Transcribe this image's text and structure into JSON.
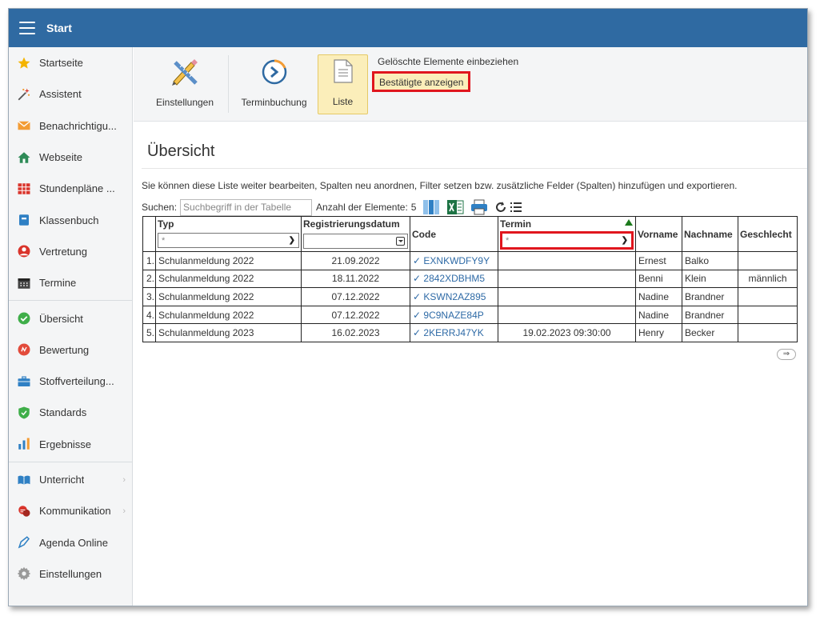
{
  "header": {
    "title": "Start"
  },
  "sidebar": {
    "group1": [
      {
        "label": "Startseite",
        "icon": "star-icon",
        "color": "#f4b400"
      },
      {
        "label": "Assistent",
        "icon": "magic-wand-icon",
        "color": "#d9342b"
      },
      {
        "label": "Benachrichtigu...",
        "icon": "envelope-icon",
        "color": "#f39c34"
      },
      {
        "label": "Webseite",
        "icon": "house-icon",
        "color": "#2e8b57"
      },
      {
        "label": "Stundenpläne ...",
        "icon": "grid-calendar-icon",
        "color": "#d9342b"
      },
      {
        "label": "Klassenbuch",
        "icon": "book-icon",
        "color": "#2f80c4"
      },
      {
        "label": "Vertretung",
        "icon": "person-icon",
        "color": "#d9342b"
      },
      {
        "label": "Termine",
        "icon": "calendar-icon",
        "color": "#444444"
      }
    ],
    "group2": [
      {
        "label": "Übersicht",
        "icon": "check-circle-icon",
        "color": "#3fae49"
      },
      {
        "label": "Bewertung",
        "icon": "rating-circle-icon",
        "color": "#e24b3b"
      },
      {
        "label": "Stoffverteilung...",
        "icon": "briefcase-icon",
        "color": "#2f80c4"
      },
      {
        "label": "Standards",
        "icon": "shield-check-icon",
        "color": "#3fae49"
      },
      {
        "label": "Ergebnisse",
        "icon": "bar-chart-icon",
        "color": "#2f80c4"
      }
    ],
    "group3": [
      {
        "label": "Unterricht",
        "icon": "open-book-icon",
        "color": "#2f80c4",
        "chevron": "›"
      },
      {
        "label": "Kommunikation",
        "icon": "chat-bubbles-icon",
        "color": "#d9342b",
        "chevron": "›"
      },
      {
        "label": "Agenda Online",
        "icon": "pen-icon",
        "color": "#2f80c4"
      },
      {
        "label": "Einstellungen",
        "icon": "gear-icon",
        "color": "#9a9a9a"
      }
    ]
  },
  "toolbar": {
    "einstellungen": "Einstellungen",
    "terminbuchung": "Terminbuchung",
    "liste": "Liste",
    "deleted_option": "Gelöschte Elemente einbeziehen",
    "confirmed_option": "Bestätigte anzeigen"
  },
  "main": {
    "title": "Übersicht",
    "description": "Sie können diese Liste weiter bearbeiten, Spalten neu anordnen, Filter setzen bzw. zusätzliche Felder (Spalten) hinzufügen und exportieren.",
    "search_label": "Suchen:",
    "search_placeholder": "Suchbegriff in der Tabelle",
    "count_label": "Anzahl der Elemente:",
    "count_value": "5"
  },
  "table": {
    "headers": {
      "typ": "Typ",
      "reg": "Registrierungsdatum",
      "code": "Code",
      "termin": "Termin",
      "vorname": "Vorname",
      "nachname": "Nachname",
      "geschlecht": "Geschlecht"
    },
    "filters": {
      "typ": "*",
      "termin": "*"
    },
    "rows": [
      {
        "idx": "1.",
        "typ": "Schulanmeldung 2022",
        "reg": "21.09.2022",
        "code": "✓ EXNKWDFY9Y",
        "termin": "",
        "vorname": "Ernest",
        "nachname": "Balko",
        "geschlecht": ""
      },
      {
        "idx": "2.",
        "typ": "Schulanmeldung 2022",
        "reg": "18.11.2022",
        "code": "✓ 2842XDBHM5",
        "termin": "",
        "vorname": "Benni",
        "nachname": "Klein",
        "geschlecht": "männlich"
      },
      {
        "idx": "3.",
        "typ": "Schulanmeldung 2022",
        "reg": "07.12.2022",
        "code": "✓ KSWN2AZ895",
        "termin": "",
        "vorname": "Nadine",
        "nachname": "Brandner",
        "geschlecht": ""
      },
      {
        "idx": "4.",
        "typ": "Schulanmeldung 2022",
        "reg": "07.12.2022",
        "code": "✓ 9C9NAZE84P",
        "termin": "",
        "vorname": "Nadine",
        "nachname": "Brandner",
        "geschlecht": ""
      },
      {
        "idx": "5.",
        "typ": "Schulanmeldung 2023",
        "reg": "16.02.2023",
        "code": "✓ 2KERRJ47YK",
        "termin": "19.02.2023 09:30:00",
        "vorname": "Henry",
        "nachname": "Becker",
        "geschlecht": ""
      }
    ]
  }
}
